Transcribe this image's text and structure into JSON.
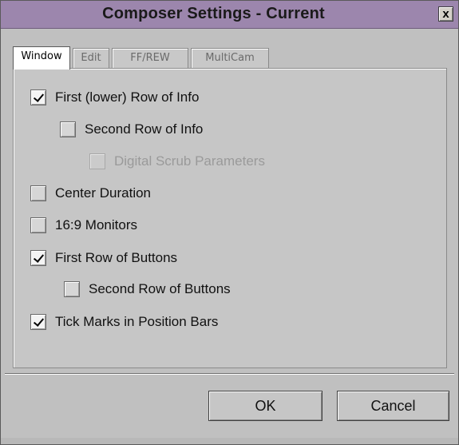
{
  "window": {
    "title": "Composer Settings - Current",
    "close_label": "x"
  },
  "tabs": [
    {
      "label": "Window",
      "active": true
    },
    {
      "label": "Edit",
      "active": false
    },
    {
      "label": "FF/REW",
      "active": false
    },
    {
      "label": "MultiCam",
      "active": false
    }
  ],
  "options": [
    {
      "label": "First (lower) Row of Info",
      "checked": true,
      "enabled": true
    },
    {
      "label": "Second Row of Info",
      "checked": false,
      "enabled": true
    },
    {
      "label": "Digital Scrub Parameters",
      "checked": false,
      "enabled": false
    },
    {
      "label": "Center Duration",
      "checked": false,
      "enabled": true
    },
    {
      "label": "16:9 Monitors",
      "checked": false,
      "enabled": true
    },
    {
      "label": "First Row of Buttons",
      "checked": true,
      "enabled": true
    },
    {
      "label": "Second Row of Buttons",
      "checked": false,
      "enabled": true
    },
    {
      "label": "Tick Marks in Position Bars",
      "checked": true,
      "enabled": true
    }
  ],
  "buttons": {
    "ok_label": "OK",
    "cancel_label": "Cancel"
  }
}
